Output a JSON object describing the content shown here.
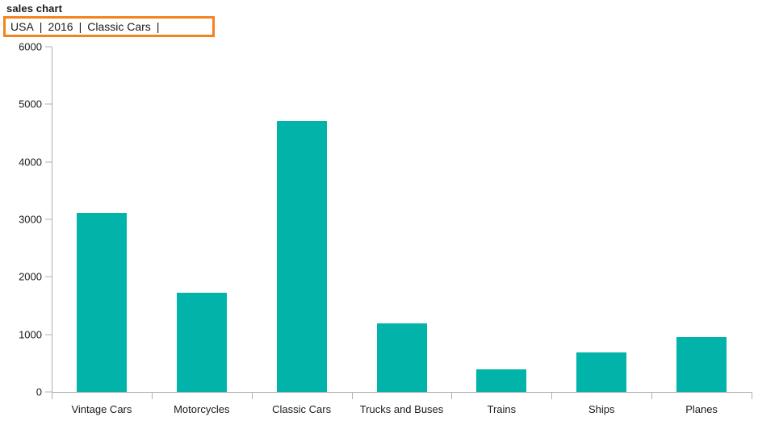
{
  "header": {
    "title": "sales chart",
    "breadcrumb": {
      "separator": "|",
      "items": [
        "USA",
        "2016",
        "Classic Cars"
      ]
    }
  },
  "colors": {
    "bar": "#02B3AA",
    "breadcrumb_border": "#F58220",
    "axis": "#b0b0b0",
    "text": "#1b1b1b"
  },
  "chart_data": {
    "type": "bar",
    "title": "sales chart",
    "xlabel": "",
    "ylabel": "",
    "ylim": [
      0,
      6000
    ],
    "yticks": [
      0,
      1000,
      2000,
      3000,
      4000,
      5000,
      6000
    ],
    "ytick_labels": [
      "0",
      "1000",
      "2000",
      "3000",
      "4000",
      "5000",
      "6000"
    ],
    "grid": false,
    "legend": false,
    "categories": [
      "Vintage Cars",
      "Motorcycles",
      "Classic Cars",
      "Trucks and Buses",
      "Trains",
      "Ships",
      "Planes"
    ],
    "values": [
      3110,
      1725,
      4710,
      1190,
      395,
      690,
      955
    ]
  }
}
